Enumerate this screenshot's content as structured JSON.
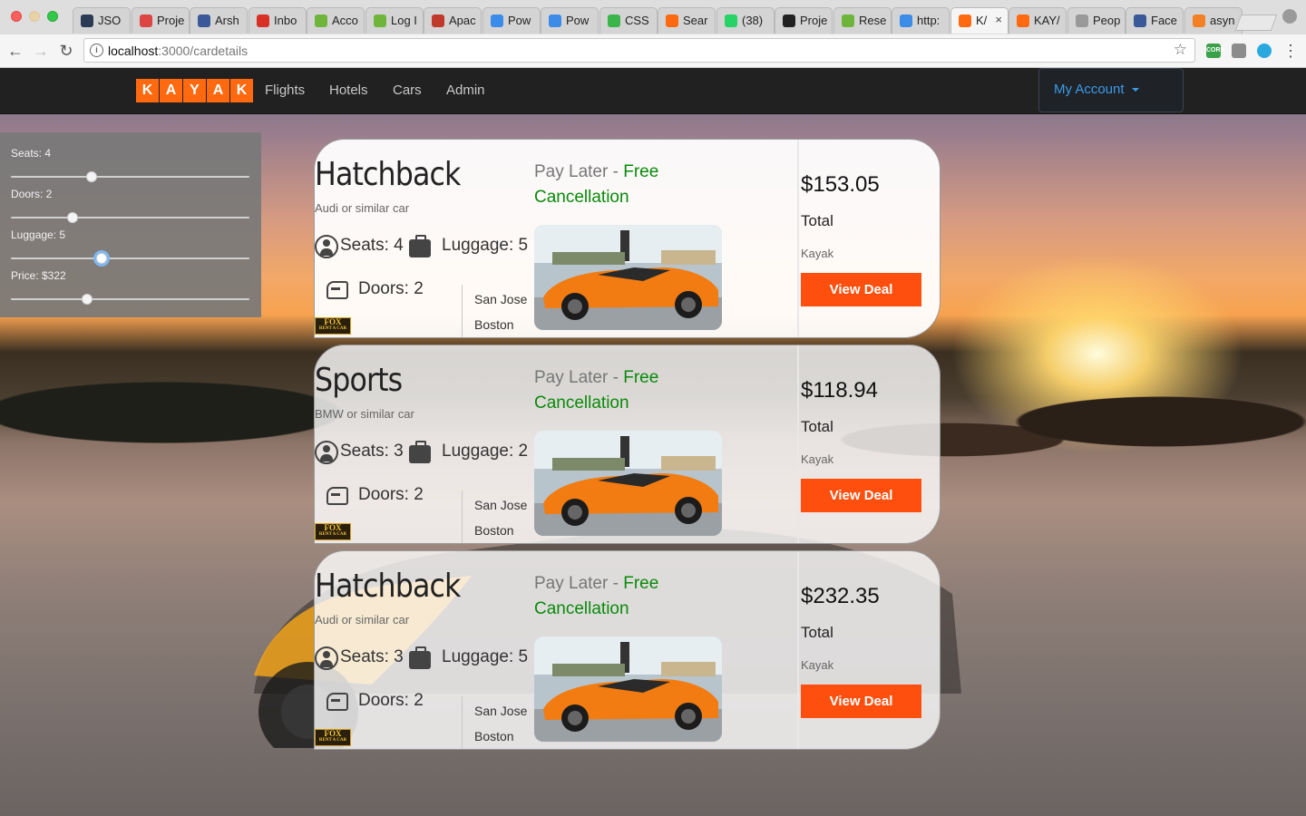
{
  "browser": {
    "tabs": [
      {
        "title": "JSO",
        "icon": "json-icon",
        "color": "#2b3a55"
      },
      {
        "title": "Proje",
        "icon": "project-icon",
        "color": "#d44"
      },
      {
        "title": "Arsh",
        "icon": "facebook-icon",
        "color": "#3b5998"
      },
      {
        "title": "Inbo",
        "icon": "gmail-icon",
        "color": "#d93025"
      },
      {
        "title": "Acco",
        "icon": "account-icon",
        "color": "#6fb53b"
      },
      {
        "title": "Log I",
        "icon": "log-icon",
        "color": "#6fb53b"
      },
      {
        "title": "Apac",
        "icon": "apache-icon",
        "color": "#c0392b"
      },
      {
        "title": "Pow",
        "icon": "powerpoint-icon",
        "color": "#3b8be8"
      },
      {
        "title": "Pow",
        "icon": "powerpoint-icon",
        "color": "#3b8be8"
      },
      {
        "title": "CSS",
        "icon": "css-icon",
        "color": "#3bb54a"
      },
      {
        "title": "Sear",
        "icon": "kayak-icon",
        "color": "#ff690f"
      },
      {
        "title": "(38)",
        "icon": "whatsapp-icon",
        "color": "#25d366"
      },
      {
        "title": "Proje",
        "icon": "github-icon",
        "color": "#222"
      },
      {
        "title": "Rese",
        "icon": "research-icon",
        "color": "#6fb53b"
      },
      {
        "title": "http:",
        "icon": "link-icon",
        "color": "#3b8be8"
      },
      {
        "title": "K/",
        "icon": "kayak-icon",
        "color": "#ff690f",
        "active": true
      },
      {
        "title": "KAY/",
        "icon": "kayak-icon",
        "color": "#ff690f"
      },
      {
        "title": "Peop",
        "icon": "document-icon",
        "color": "#999"
      },
      {
        "title": "Face",
        "icon": "facebook-icon",
        "color": "#3b5998"
      },
      {
        "title": "asyn",
        "icon": "stackoverflow-icon",
        "color": "#f48024"
      }
    ],
    "url_host": "localhost",
    "url_path": ":3000/cardetails"
  },
  "nav": {
    "logo_letters": [
      "K",
      "A",
      "Y",
      "A",
      "K"
    ],
    "links": [
      "Flights",
      "Hotels",
      "Cars",
      "Admin"
    ],
    "account": "My Account"
  },
  "filters": [
    {
      "label": "Seats: 4",
      "fraction": 0.34
    },
    {
      "label": "Doors: 2",
      "fraction": 0.26
    },
    {
      "label": "Luggage: 5",
      "fraction": 0.38
    },
    {
      "label": "Price: $322",
      "fraction": 0.32
    }
  ],
  "cards": [
    {
      "name": "Hatchback",
      "sub": "Audi or similar car",
      "seats": "Seats: 4",
      "luggage": "Luggage: 5",
      "doors": "Doors: 2",
      "pickup": "San Jose",
      "dropoff": "Boston",
      "pay": "Pay Later",
      "dash": " - ",
      "free": "Free",
      "cancel": "Cancellation",
      "price": "$153.05",
      "total": "Total",
      "provider": "Kayak",
      "button": "View Deal"
    },
    {
      "name": "Sports",
      "sub": "BMW or similar car",
      "seats": "Seats: 3",
      "luggage": "Luggage: 2",
      "doors": "Doors: 2",
      "pickup": "San Jose",
      "dropoff": "Boston",
      "pay": "Pay Later",
      "dash": " - ",
      "free": "Free",
      "cancel": "Cancellation",
      "price": "$118.94",
      "total": "Total",
      "provider": "Kayak",
      "button": "View Deal"
    },
    {
      "name": "Hatchback",
      "sub": "Audi or similar car",
      "seats": "Seats: 3",
      "luggage": "Luggage: 5",
      "doors": "Doors: 2",
      "pickup": "San Jose",
      "dropoff": "Boston",
      "pay": "Pay Later",
      "dash": " - ",
      "free": "Free",
      "cancel": "Cancellation",
      "price": "$232.35",
      "total": "Total",
      "provider": "Kayak",
      "button": "View Deal"
    }
  ],
  "rental_logo": {
    "line1": "FOX",
    "line2": "RENT A CAR"
  },
  "colors": {
    "brand": "#ff690f",
    "deal_button": "#ff4f0f",
    "free_green": "#0a8a0a",
    "account_blue": "#3b9be8"
  }
}
